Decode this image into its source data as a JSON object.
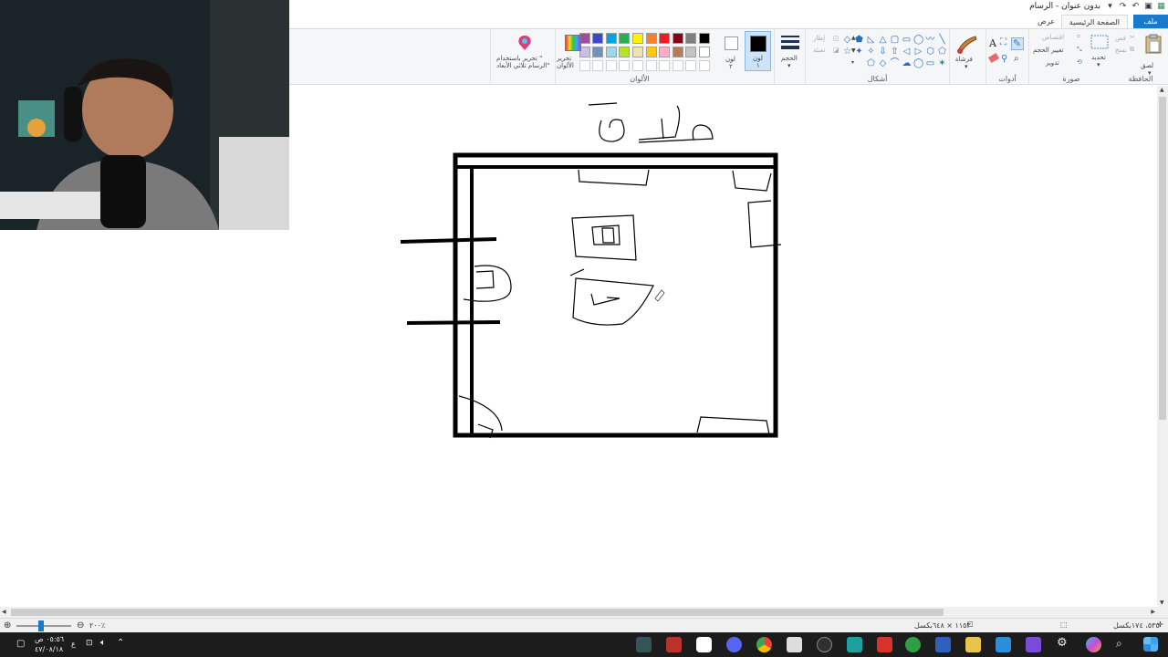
{
  "window": {
    "title": "بدون عنوان - الرسام"
  },
  "tabs": {
    "file": "ملف",
    "home": "الصفحة الرئيسية",
    "view": "عرض"
  },
  "clipboard": {
    "paste": "لصق",
    "cut": "قص",
    "copy": "نسخ",
    "group": "الحافظة"
  },
  "image": {
    "select": "تحديد",
    "crop": "اقتصاص",
    "resize": "تغيير الحجم",
    "rotate": "تدوير",
    "group": "صورة"
  },
  "tools": {
    "group": "أدوات",
    "text_glyph": "A"
  },
  "brushes": {
    "label": "فرشاة"
  },
  "shapes": {
    "outline": "إطار",
    "fill": "تعبئة",
    "group": "أشكال"
  },
  "size": {
    "label": "الحجم"
  },
  "color1": {
    "label": "لون",
    "num": "١"
  },
  "color2": {
    "label": "لون",
    "num": "٢"
  },
  "colors": {
    "group": "الألوان",
    "row1": [
      "#000000",
      "#7f7f7f",
      "#880015",
      "#ed1c24",
      "#ff7f27",
      "#fff200",
      "#22b14c",
      "#00a2e8",
      "#3f48cc",
      "#a349a4"
    ],
    "row2": [
      "#ffffff",
      "#c3c3c3",
      "#b97a57",
      "#ffaec9",
      "#ffc90e",
      "#efe4b0",
      "#b5e61d",
      "#99d9ea",
      "#7092be",
      "#c8bfe7"
    ]
  },
  "edit_colors": {
    "line1": "تحرير",
    "line2": "الألوان"
  },
  "paint3d": {
    "line1": "تحرير باستخدام \"",
    "line2": "الرسام ثلاثي الأبعاد\""
  },
  "statusbar": {
    "cursor": "٥٣٥، ١٧٤بكسل",
    "size": "١١٥٣ × ٦٤٨بكسل",
    "zoom": "٢٠٠٪"
  },
  "taskbar": {
    "time": "٠٥:٥٦ ص",
    "date": "٤٧/٠٨/١٨",
    "lang": "ع"
  },
  "drawing": {
    "caption": "ستارة"
  }
}
